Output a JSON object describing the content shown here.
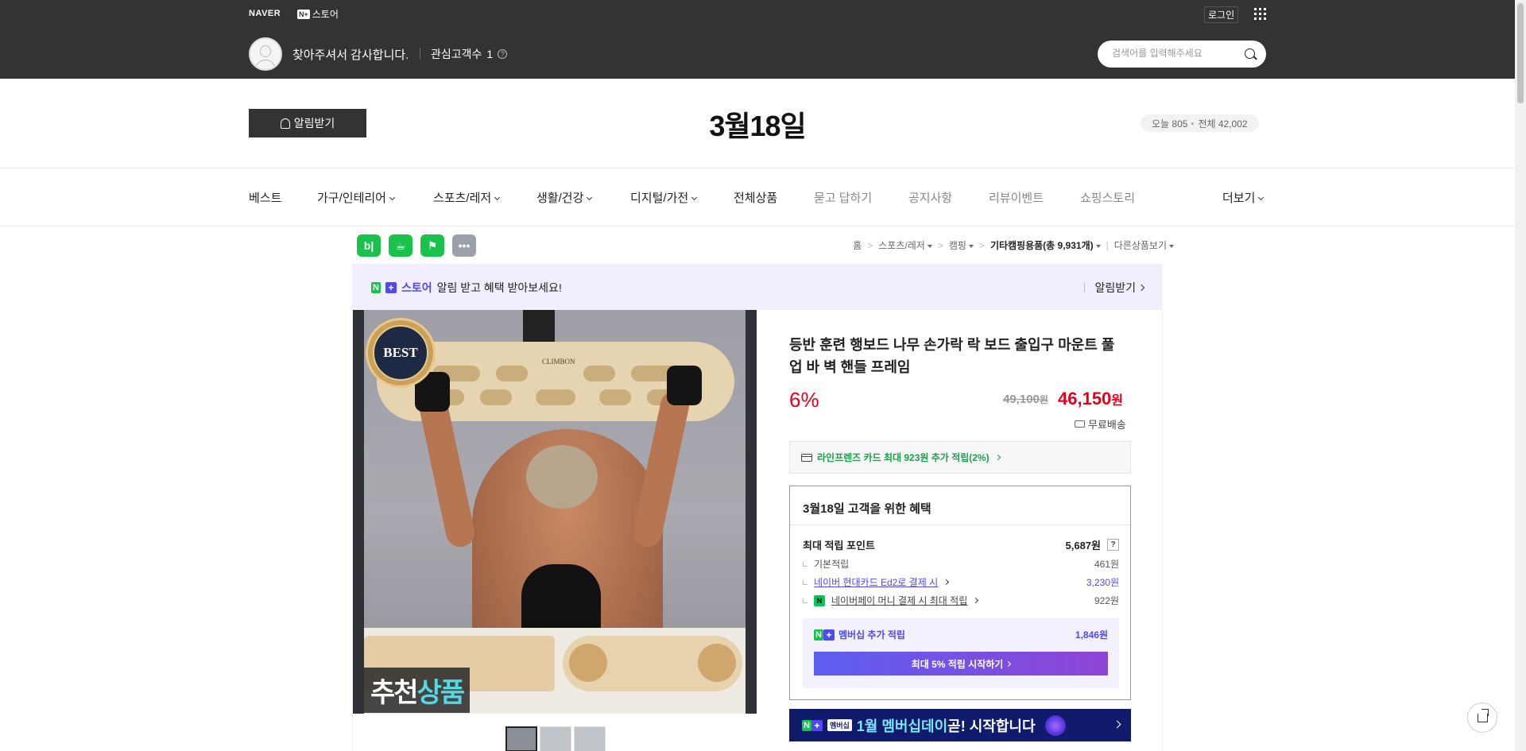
{
  "topbar": {
    "naver_logo": "NAVER",
    "store_badge": "N+",
    "store_label": "스토어",
    "login": "로그인",
    "greeting": "찾아주셔서 감사합니다.",
    "interest_label": "관심고객수",
    "interest_count": "1",
    "search_placeholder": "검색어를 입력해주세요"
  },
  "header": {
    "alarm_button": "알림받기",
    "store_title": "3월18일",
    "visit_today": "오늘 805",
    "visit_total": "전체 42,002"
  },
  "nav": {
    "items": [
      {
        "label": "베스트",
        "dropdown": false
      },
      {
        "label": "가구/인테리어",
        "dropdown": true
      },
      {
        "label": "스포츠/레저",
        "dropdown": true
      },
      {
        "label": "생활/건강",
        "dropdown": true
      },
      {
        "label": "디지털/가전",
        "dropdown": true
      },
      {
        "label": "전체상품",
        "dropdown": false
      },
      {
        "label": "묻고 답하기",
        "dropdown": false
      },
      {
        "label": "공지사항",
        "dropdown": false
      },
      {
        "label": "리뷰이벤트",
        "dropdown": false
      },
      {
        "label": "쇼핑스토리",
        "dropdown": false
      }
    ],
    "more": "더보기"
  },
  "share_icons": [
    {
      "name": "blog-share-icon",
      "glyph": "b|",
      "color": "#19c24b"
    },
    {
      "name": "cafe-share-icon",
      "glyph": "☕",
      "color": "#19c24b"
    },
    {
      "name": "bookmark-share-icon",
      "glyph": "⚑",
      "color": "#19c24b"
    },
    {
      "name": "more-share-icon",
      "glyph": "•••",
      "color": "#9aa0a6"
    }
  ],
  "breadcrumb": {
    "home": "홈",
    "cat1": "스포츠/레저",
    "cat2": "캠핑",
    "cat3": "기타캠핑용품(총 9,931개)",
    "other": "다른상품보기"
  },
  "banner": {
    "badge": "N",
    "brand": "스토어",
    "text": "알림 받고 혜택 받아보세요!",
    "action": "알림받기"
  },
  "product_image": {
    "best_badge": "BEST",
    "brand_text": "CLIMBON",
    "caption_white": "추천",
    "caption_accent": "상품"
  },
  "thumbs": [
    {
      "selected": true
    },
    {
      "selected": false
    },
    {
      "selected": false
    }
  ],
  "product": {
    "name": "등반 훈련 행보드 나무 손가락 락 보드 출입구 마운트 풀 업 바 벽 핸들 프레임",
    "discount": "6%",
    "original_price": "49,100",
    "price": "46,150",
    "currency": "원",
    "shipping": "무료배송",
    "card_offer": "라인프렌즈 카드 최대 923원 추가 적립(2%)"
  },
  "benefit": {
    "title": "3월18일 고객을 위한 혜택",
    "max_points_label": "최대 적립 포인트",
    "max_points": "5,687원",
    "basic_label": "기본적립",
    "basic_value": "461원",
    "card_label": "네이버 현대카드 Ed2로 결제 시",
    "card_value": "3,230원",
    "pay_label": "네이버페이 머니 결제 시 최대 적립",
    "pay_value": "922원",
    "member_label": "멤버십 추가 적립",
    "member_value": "1,846원",
    "member_button": "최대 5% 적립 시작하기"
  },
  "membership_ad": {
    "badge": "N+",
    "sub": "멤버십",
    "text_highlight": "1월 멤버십데이",
    "text": "곧! 시작합니다"
  }
}
